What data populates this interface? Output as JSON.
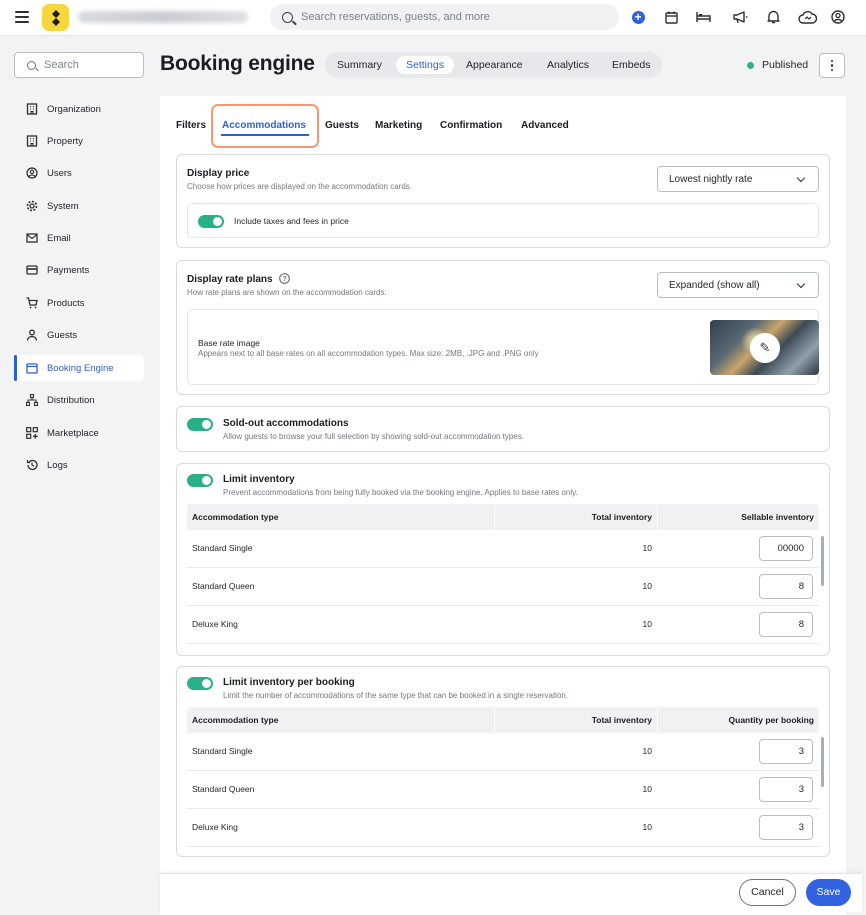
{
  "topbar": {
    "search_placeholder": "Search reservations, guests, and more",
    "icons": [
      "menu-icon",
      "add-icon",
      "calendar-icon",
      "bed-icon",
      "megaphone-icon",
      "bell-icon",
      "cloud-icon",
      "user-icon"
    ]
  },
  "sidebar": {
    "search_placeholder": "Search",
    "items": [
      {
        "label": "Organization",
        "icon": "building-icon"
      },
      {
        "label": "Property",
        "icon": "property-icon"
      },
      {
        "label": "Users",
        "icon": "user-circle-icon"
      },
      {
        "label": "System",
        "icon": "gear-icon"
      },
      {
        "label": "Email",
        "icon": "mail-icon"
      },
      {
        "label": "Payments",
        "icon": "card-icon"
      },
      {
        "label": "Products",
        "icon": "cart-icon"
      },
      {
        "label": "Guests",
        "icon": "person-icon"
      },
      {
        "label": "Booking Engine",
        "icon": "browser-icon"
      },
      {
        "label": "Distribution",
        "icon": "hierarchy-icon"
      },
      {
        "label": "Marketplace",
        "icon": "apps-icon"
      },
      {
        "label": "Logs",
        "icon": "history-icon"
      }
    ]
  },
  "header": {
    "title": "Booking engine",
    "tabs": [
      "Summary",
      "Settings",
      "Appearance",
      "Analytics",
      "Embeds"
    ],
    "active_tab": "Settings",
    "status": "Published",
    "status_color": "#33b583"
  },
  "subtabs": [
    "Filters",
    "Accommodations",
    "Guests",
    "Marketing",
    "Confirmation",
    "Advanced"
  ],
  "display_price": {
    "title": "Display price",
    "desc": "Choose how prices are displayed on the accommodation cards.",
    "select_value": "Lowest nightly rate",
    "toggle_label": "Include taxes and fees in price"
  },
  "display_rate_plans": {
    "title": "Display rate plans",
    "desc": "How rate plans are shown on the accommodation cards.",
    "select_value": "Expanded (show all)",
    "image_title": "Base rate image",
    "image_desc": "Appears next to all base rates on all accommodation types. Max size: 2MB, .JPG and .PNG only"
  },
  "sold_out": {
    "title": "Sold-out accommodations",
    "desc": "Allow guests to browse your full selection by showing sold-out accommodation types."
  },
  "limit_inventory": {
    "title": "Limit inventory",
    "desc": "Prevent accommodations from being fully booked via the booking engine. Applies to base rates only.",
    "columns": [
      "Accommodation type",
      "Total inventory",
      "Sellable inventory"
    ],
    "rows": [
      {
        "type": "Standard Single",
        "total": "10",
        "value": "00000"
      },
      {
        "type": "Standard Queen",
        "total": "10",
        "value": "8"
      },
      {
        "type": "Deluxe King",
        "total": "10",
        "value": "8"
      }
    ]
  },
  "limit_per_booking": {
    "title": "Limit inventory per booking",
    "desc": "Limit the number of accommodations of the same type that can be booked in a single reservation.",
    "columns": [
      "Accommodation type",
      "Total inventory",
      "Quantity per booking"
    ],
    "rows": [
      {
        "type": "Standard Single",
        "total": "10",
        "value": "3"
      },
      {
        "type": "Standard Queen",
        "total": "10",
        "value": "3"
      },
      {
        "type": "Deluxe King",
        "total": "10",
        "value": "3"
      }
    ]
  },
  "footer": {
    "cancel": "Cancel",
    "save": "Save"
  },
  "colors": {
    "accent": "#2d5fd6",
    "toggle_on": "#27b08a",
    "highlight": "#f49871"
  }
}
